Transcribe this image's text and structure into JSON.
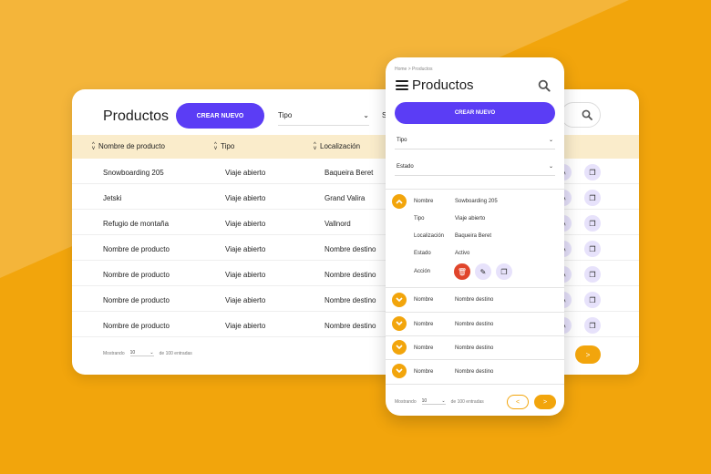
{
  "desktop": {
    "title": "Productos",
    "create_label": "CREAR NUEVO",
    "tipo_label": "Tipo",
    "estado_cut": "S",
    "columns": [
      "Nombre de producto",
      "Tipo",
      "Localización"
    ],
    "rows": [
      {
        "name": "Snowboarding 205",
        "type": "Viaje abierto",
        "loc": "Baqueira Beret"
      },
      {
        "name": "Jetski",
        "type": "Viaje abierto",
        "loc": "Grand Valira"
      },
      {
        "name": "Refugio de montaña",
        "type": "Viaje abierto",
        "loc": "Vallnord"
      },
      {
        "name": "Nombre de producto",
        "type": "Viaje abierto",
        "loc": "Nombre destino"
      },
      {
        "name": "Nombre de producto",
        "type": "Viaje abierto",
        "loc": "Nombre destino"
      },
      {
        "name": "Nombre de producto",
        "type": "Viaje abierto",
        "loc": "Nombre destino"
      },
      {
        "name": "Nombre de producto",
        "type": "Viaje abierto",
        "loc": "Nombre destino"
      }
    ],
    "footer": {
      "showing": "Mostrando",
      "per_page": "10",
      "of_total": "de 100 entradas"
    },
    "next_label": ">"
  },
  "mobile": {
    "breadcrumb": "Home > Productos",
    "title": "Productos",
    "create_label": "CREAR NUEVO",
    "tipo_label": "Tipo",
    "estado_label": "Estado",
    "expanded": {
      "labels": {
        "name": "Nombre",
        "type": "Tipo",
        "loc": "Localización",
        "status": "Estado",
        "action": "Acción"
      },
      "values": {
        "name": "Sowboarding 205",
        "type": "Viaje abierto",
        "loc": "Baqueira Beret",
        "status": "Activo"
      }
    },
    "collapsed": [
      {
        "label": "Nombre",
        "value": "Nombre destino"
      },
      {
        "label": "Nombre",
        "value": "Nombre destino"
      },
      {
        "label": "Nombre",
        "value": "Nombre destino"
      },
      {
        "label": "Nombre",
        "value": "Nombre destino"
      }
    ],
    "footer": {
      "showing": "Mostrando",
      "per_page": "10",
      "of_total": "de 100 entradas"
    },
    "prev_label": "<",
    "next_label": ">"
  },
  "colors": {
    "accent": "#5b3df5",
    "brand": "#f2a50c",
    "header_bg": "#faeccb",
    "delete": "#e0452b",
    "action_bg": "#e7e2fb"
  },
  "icons": [
    "search-icon",
    "edit-icon",
    "copy-icon",
    "delete-icon",
    "menu-icon",
    "chevron-up-icon",
    "chevron-down-icon",
    "sort-icon"
  ]
}
